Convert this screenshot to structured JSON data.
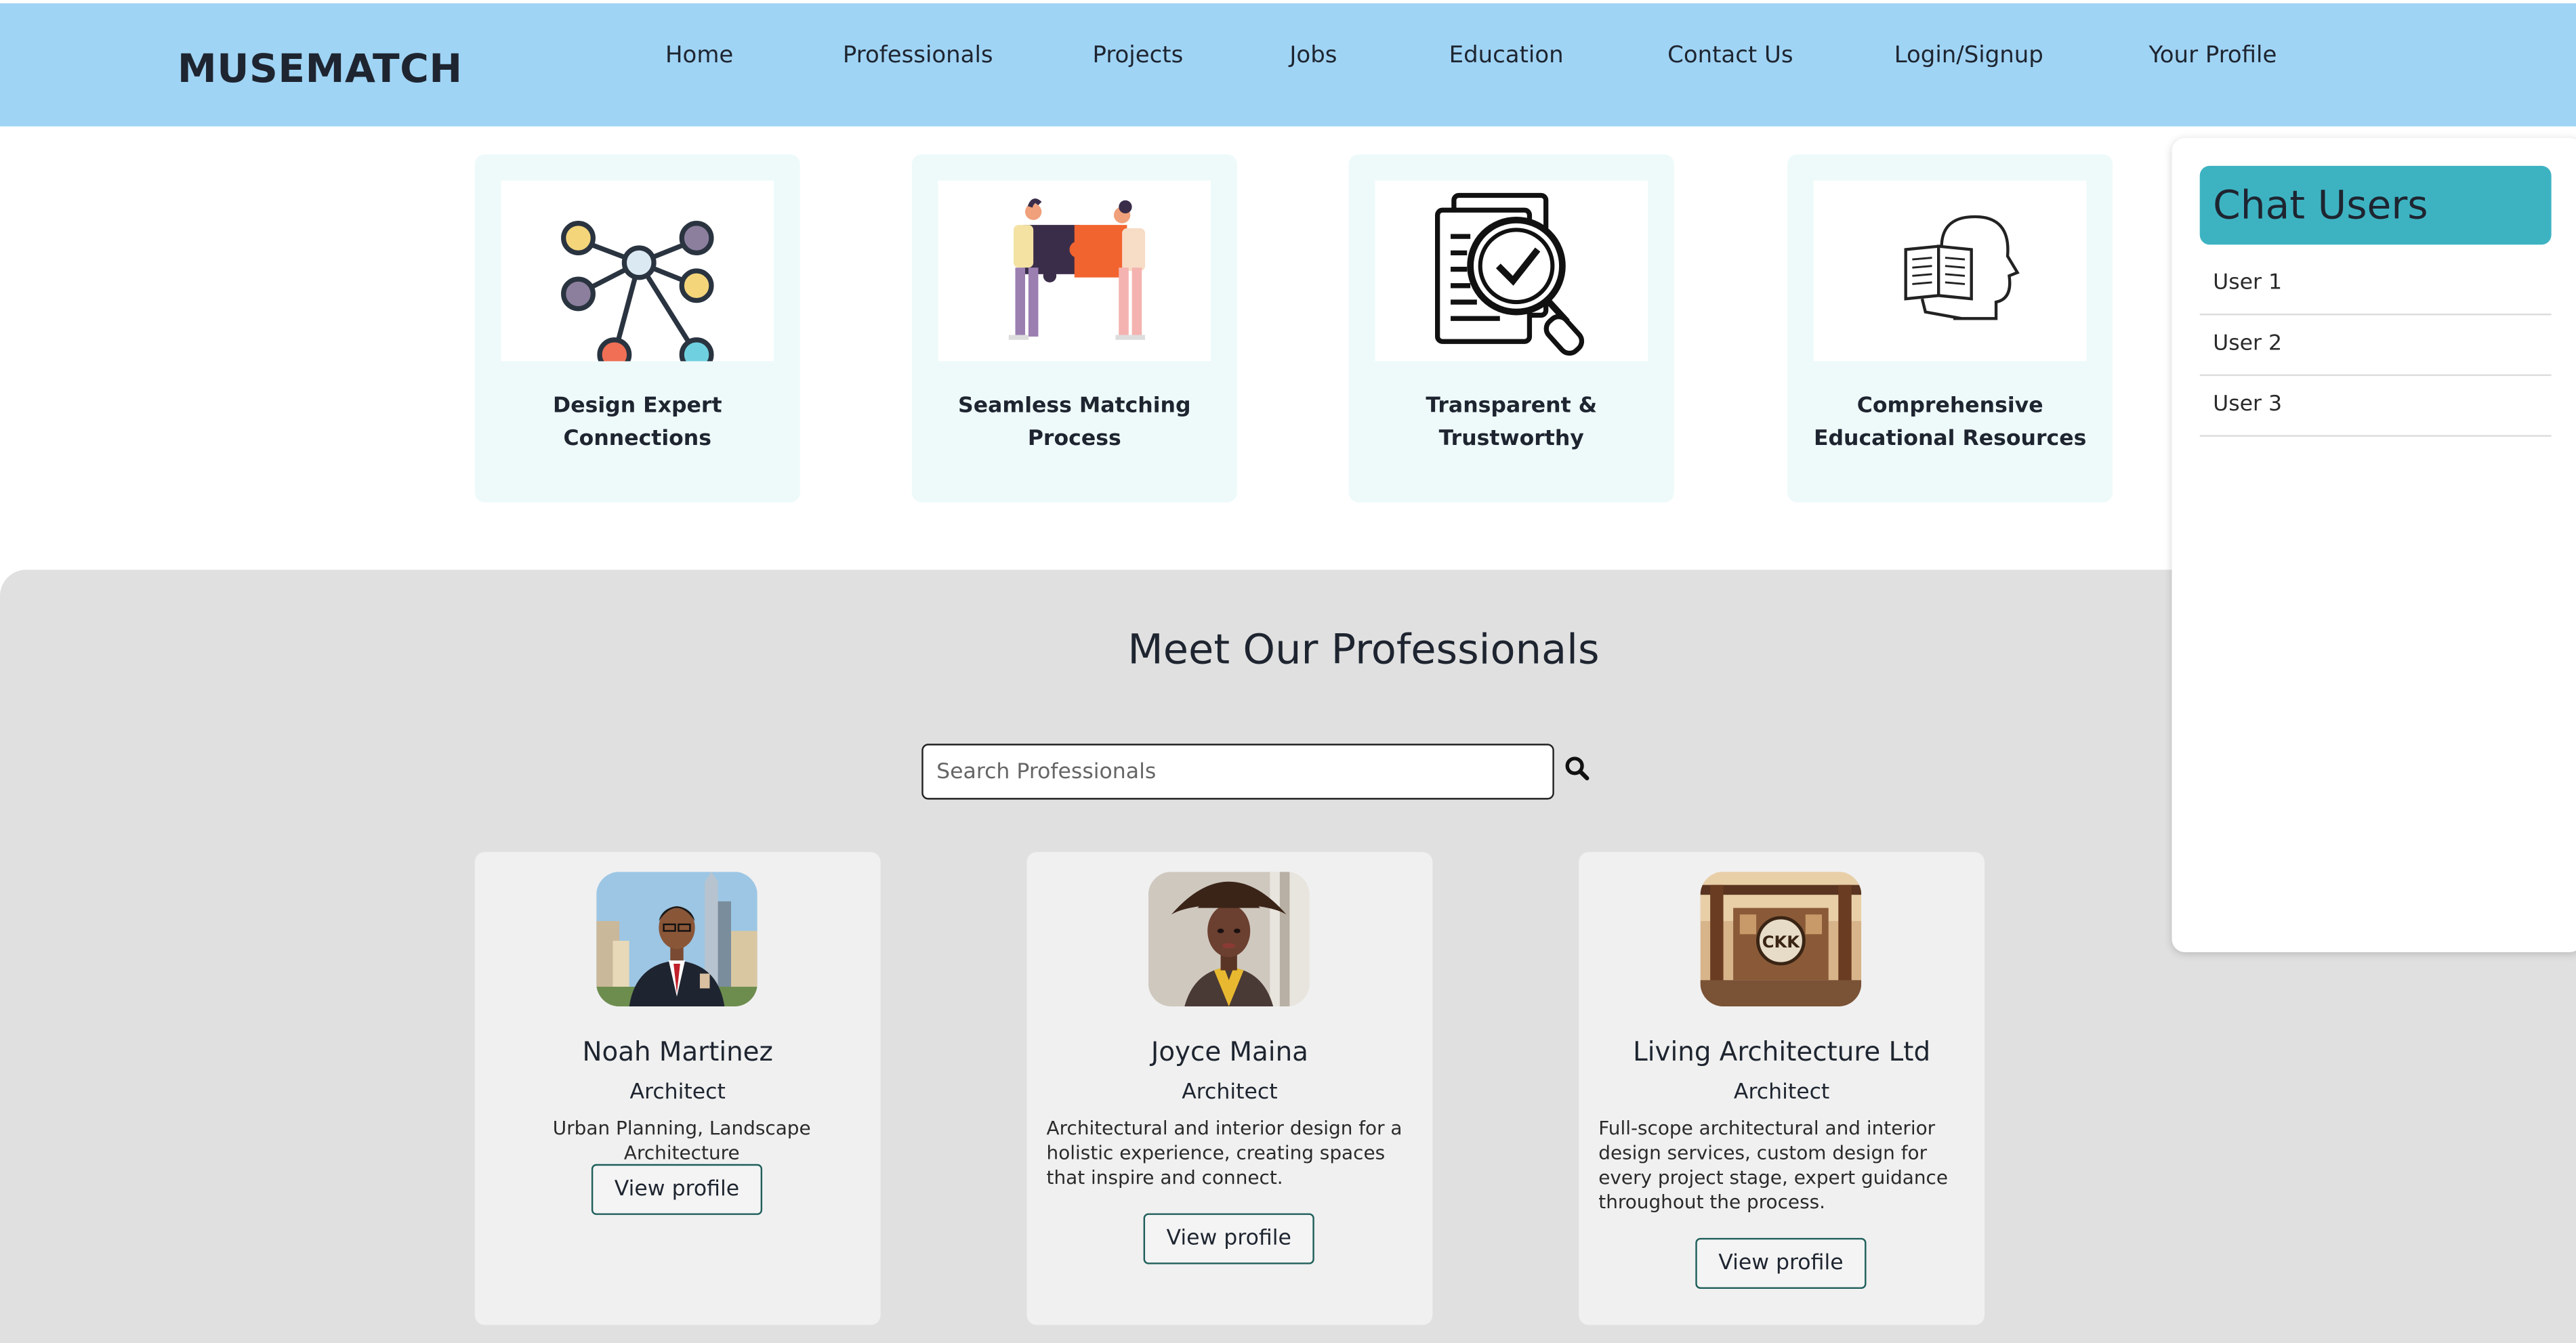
{
  "brand": {
    "logo_text": "MUSEMATCH"
  },
  "nav": {
    "items": [
      {
        "label": "Home"
      },
      {
        "label": "Professionals"
      },
      {
        "label": "Projects"
      },
      {
        "label": "Jobs"
      },
      {
        "label": "Education"
      },
      {
        "label": "Contact Us"
      },
      {
        "label": "Login/Signup"
      },
      {
        "label": "Your Profile"
      }
    ]
  },
  "features": [
    {
      "title": "Design Expert\nConnections",
      "icon": "network-nodes-icon"
    },
    {
      "title": "Seamless Matching\nProcess",
      "icon": "puzzle-people-icon"
    },
    {
      "title": "Transparent &\nTrustworthy",
      "icon": "document-check-magnifier-icon"
    },
    {
      "title": "Comprehensive\nEducational Resources",
      "icon": "head-book-icon"
    }
  ],
  "professionals_section": {
    "title": "Meet Our Professionals",
    "search": {
      "placeholder": "Search Professionals",
      "value": ""
    },
    "cards": [
      {
        "name": "Noah Martinez",
        "role": "Architect",
        "description": "Urban Planning, Landscape Architecture",
        "button_label": "View profile"
      },
      {
        "name": "Joyce Maina",
        "role": "Architect",
        "description": "Architectural and interior design for a holistic experience, creating spaces that inspire and connect.",
        "button_label": "View profile"
      },
      {
        "name": "Living Architecture Ltd",
        "role": "Architect",
        "description": "Full-scope architectural and interior design services, custom design for every project stage, expert guidance throughout the process.",
        "button_label": "View profile"
      }
    ]
  },
  "chat": {
    "title": "Chat Users",
    "users": [
      {
        "label": "User 1"
      },
      {
        "label": "User 2"
      },
      {
        "label": "User 3"
      }
    ]
  },
  "colors": {
    "header_bg": "#a0d4f5",
    "feature_bg": "#eefafa",
    "section_bg": "#e0e0e0",
    "chat_header_bg": "#3db3c2",
    "button_border": "#1f5f5b"
  }
}
